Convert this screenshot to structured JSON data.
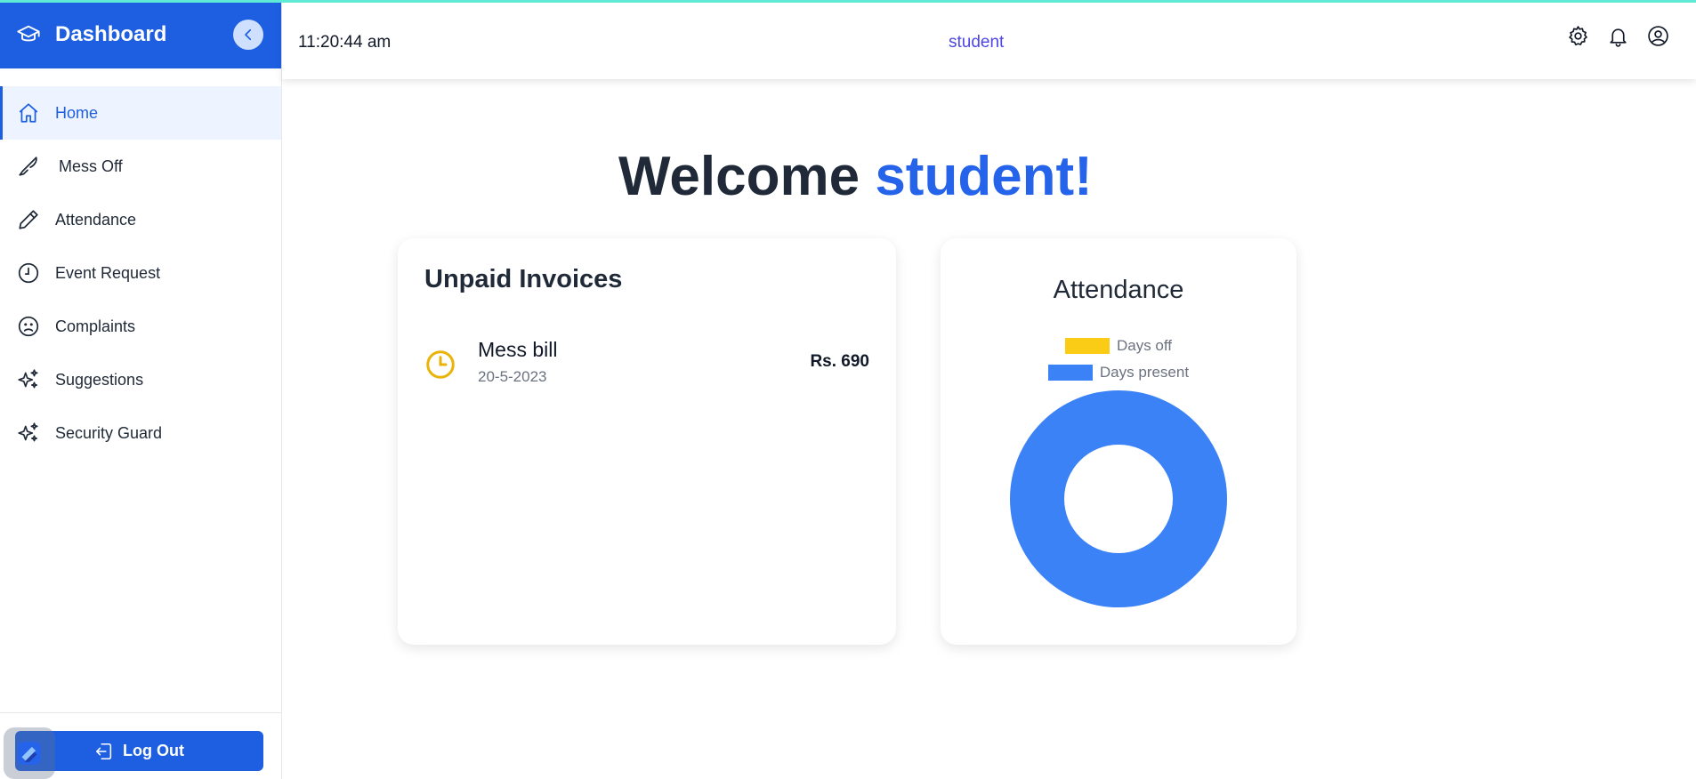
{
  "colors": {
    "primary": "#1d5fe0",
    "accent_name": "#2563eb",
    "role_text": "#4f46e5",
    "days_off": "#facc15",
    "days_present": "#3b82f6",
    "clock_icon": "#eab308"
  },
  "sidebar": {
    "title": "Dashboard",
    "logo_icon": "graduation-cap-icon",
    "collapse_icon": "chevron-left-icon",
    "items": [
      {
        "label": "Home",
        "icon": "home-icon",
        "active": true
      },
      {
        "label": "Mess Off",
        "icon": "knife-icon"
      },
      {
        "label": "Attendance",
        "icon": "pencil-icon"
      },
      {
        "label": "Event Request",
        "icon": "clock-circle-icon"
      },
      {
        "label": "Complaints",
        "icon": "frown-face-icon"
      },
      {
        "label": "Suggestions",
        "icon": "sparkles-icon"
      },
      {
        "label": "Security Guard",
        "icon": "sparkles-icon"
      }
    ],
    "logout_label": "Log Out"
  },
  "header": {
    "time": "11:20:44 am",
    "role": "student",
    "icons": [
      "gear-icon",
      "bell-icon",
      "user-circle-icon"
    ]
  },
  "main": {
    "welcome_prefix": "Welcome",
    "welcome_name": "student!",
    "invoices": {
      "title": "Unpaid Invoices",
      "items": [
        {
          "title": "Mess bill",
          "date": "20-5-2023",
          "amount": "Rs. 690"
        }
      ]
    },
    "attendance": {
      "title": "Attendance"
    }
  },
  "chart_data": {
    "type": "pie",
    "title": "Attendance",
    "categories": [
      "Days off",
      "Days present"
    ],
    "values": [
      0,
      1
    ],
    "legend_position": "top",
    "donut": true
  }
}
